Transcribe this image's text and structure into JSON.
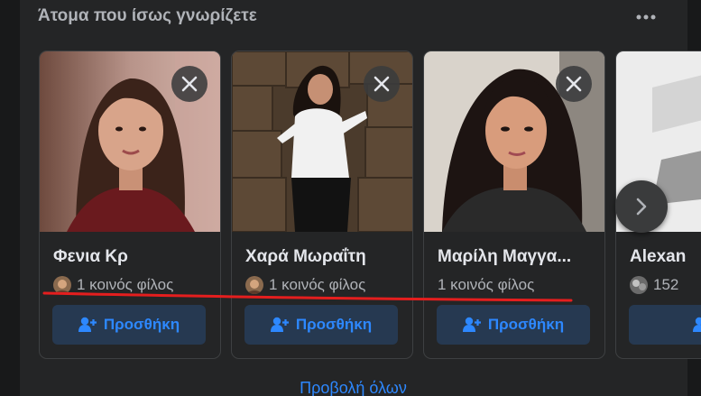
{
  "section": {
    "title": "Άτομα που ίσως γνωρίζετε"
  },
  "cards": [
    {
      "name": "Φενια Κρ",
      "mutual": "1 κοινός φίλος",
      "add_label": "Προσθήκη"
    },
    {
      "name": "Χαρά Μωραΐτη",
      "mutual": "1 κοινός φίλος",
      "add_label": "Προσθήκη"
    },
    {
      "name": "Μαρίλη Μαγγα...",
      "mutual": "1 κοινός φίλος",
      "add_label": "Προσθήκη"
    },
    {
      "name": "Alexan",
      "mutual": "152",
      "add_label": ""
    }
  ],
  "footer": {
    "see_all": "Προβολή όλων"
  },
  "colors": {
    "background": "#18191a",
    "panel": "#242526",
    "accent": "#2d88ff",
    "button_bg": "#263951",
    "annotation_line": "#e41e1e"
  },
  "icons": {
    "more": "more-horizontal-icon",
    "close": "close-icon",
    "add_friend": "add-friend-icon",
    "next": "chevron-right-icon"
  }
}
